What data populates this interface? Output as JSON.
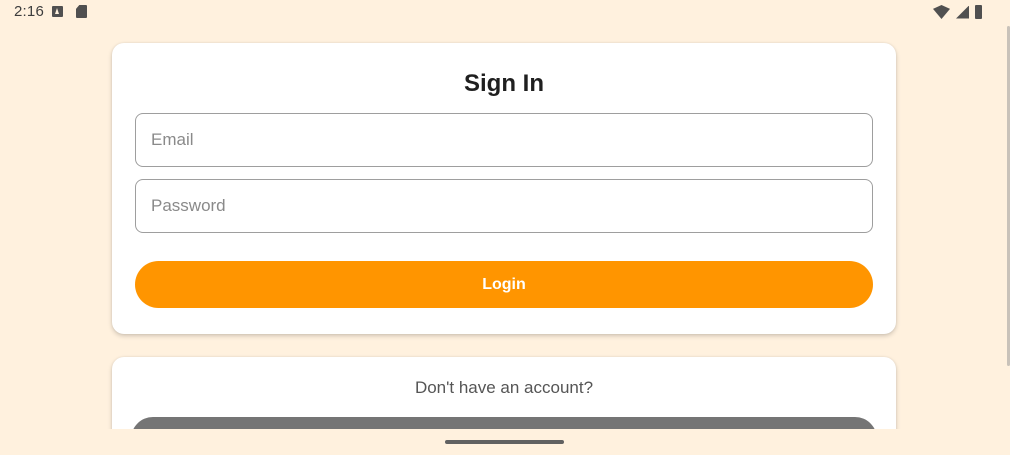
{
  "status_bar": {
    "time": "2:16",
    "notification_icons": [
      "a-notification-icon",
      "sd-card-icon"
    ],
    "system_icons": [
      "wifi-icon",
      "signal-icon",
      "battery-icon"
    ]
  },
  "signin": {
    "title": "Sign In",
    "email_placeholder": "Email",
    "email_value": "",
    "password_placeholder": "Password",
    "password_value": "",
    "login_label": "Login"
  },
  "signup": {
    "prompt": "Don't have an account?"
  },
  "colors": {
    "background": "#fff1de",
    "accent": "#ff9500",
    "secondary_button": "#757575"
  }
}
